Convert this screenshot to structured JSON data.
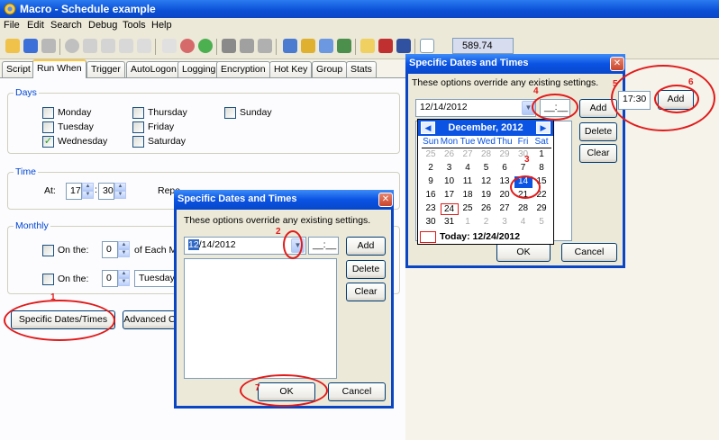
{
  "window": {
    "title": "Macro - Schedule example"
  },
  "menu": [
    "File",
    "Edit",
    "Search",
    "Debug",
    "Tools",
    "Help"
  ],
  "toolbar": {
    "field_value": "589.74"
  },
  "tabs": [
    "Script",
    "Run When",
    "Trigger",
    "AutoLogon",
    "Logging",
    "Encryption",
    "Hot Key",
    "Group",
    "Stats"
  ],
  "days": {
    "title": "Days",
    "items": [
      {
        "label": "Monday",
        "checked": false
      },
      {
        "label": "Tuesday",
        "checked": false
      },
      {
        "label": "Wednesday",
        "checked": true
      },
      {
        "label": "Thursday",
        "checked": false
      },
      {
        "label": "Friday",
        "checked": false
      },
      {
        "label": "Saturday",
        "checked": false
      },
      {
        "label": "Sunday",
        "checked": false
      }
    ]
  },
  "time": {
    "title": "Time",
    "at_label": "At:",
    "hour": "17",
    "minute": "30",
    "repeat_label": "Repe"
  },
  "monthly": {
    "title": "Monthly",
    "row1": {
      "label": "On the:",
      "value": "0",
      "suffix": "of Each M"
    },
    "row2": {
      "label": "On the:",
      "value": "0",
      "day": "Tuesday"
    }
  },
  "buttons": {
    "specific": "Specific Dates/Times",
    "advanced": "Advanced C"
  },
  "dialog_front": {
    "title": "Specific Dates and Times",
    "description": "These options override any existing settings.",
    "date_value": "12/14/2012",
    "date_highlight": "12",
    "date_rest": "/14/2012",
    "time_value": "__:__",
    "add": "Add",
    "delete": "Delete",
    "clear": "Clear",
    "ok": "OK",
    "cancel": "Cancel"
  },
  "dialog_back": {
    "title": "Specific Dates and Times",
    "description": "These options override any existing settings.",
    "date_value": "12/14/2012",
    "time_value": "__:__",
    "add": "Add",
    "delete": "Delete",
    "clear": "Clear",
    "ok": "OK",
    "cancel": "Cancel"
  },
  "calendar": {
    "month": "December, 2012",
    "days_of_week": [
      "Sun",
      "Mon",
      "Tue",
      "Wed",
      "Thu",
      "Fri",
      "Sat"
    ],
    "weeks": [
      [
        "25",
        "26",
        "27",
        "28",
        "29",
        "30",
        "1"
      ],
      [
        "2",
        "3",
        "4",
        "5",
        "6",
        "7",
        "8"
      ],
      [
        "9",
        "10",
        "11",
        "12",
        "13",
        "14",
        "15"
      ],
      [
        "16",
        "17",
        "18",
        "19",
        "20",
        "21",
        "22"
      ],
      [
        "23",
        "24",
        "25",
        "26",
        "27",
        "28",
        "29"
      ],
      [
        "30",
        "31",
        "1",
        "2",
        "3",
        "4",
        "5"
      ]
    ],
    "selected": "14",
    "today_label": "Today: 12/24/2012"
  },
  "zoom_inset": {
    "time_value": "17:30",
    "add": "Add"
  },
  "annotations": [
    "1",
    "2",
    "3",
    "4",
    "5",
    "6",
    "7"
  ],
  "colors": {
    "accent": "#0a53e3",
    "annotation": "#e11b1b"
  }
}
